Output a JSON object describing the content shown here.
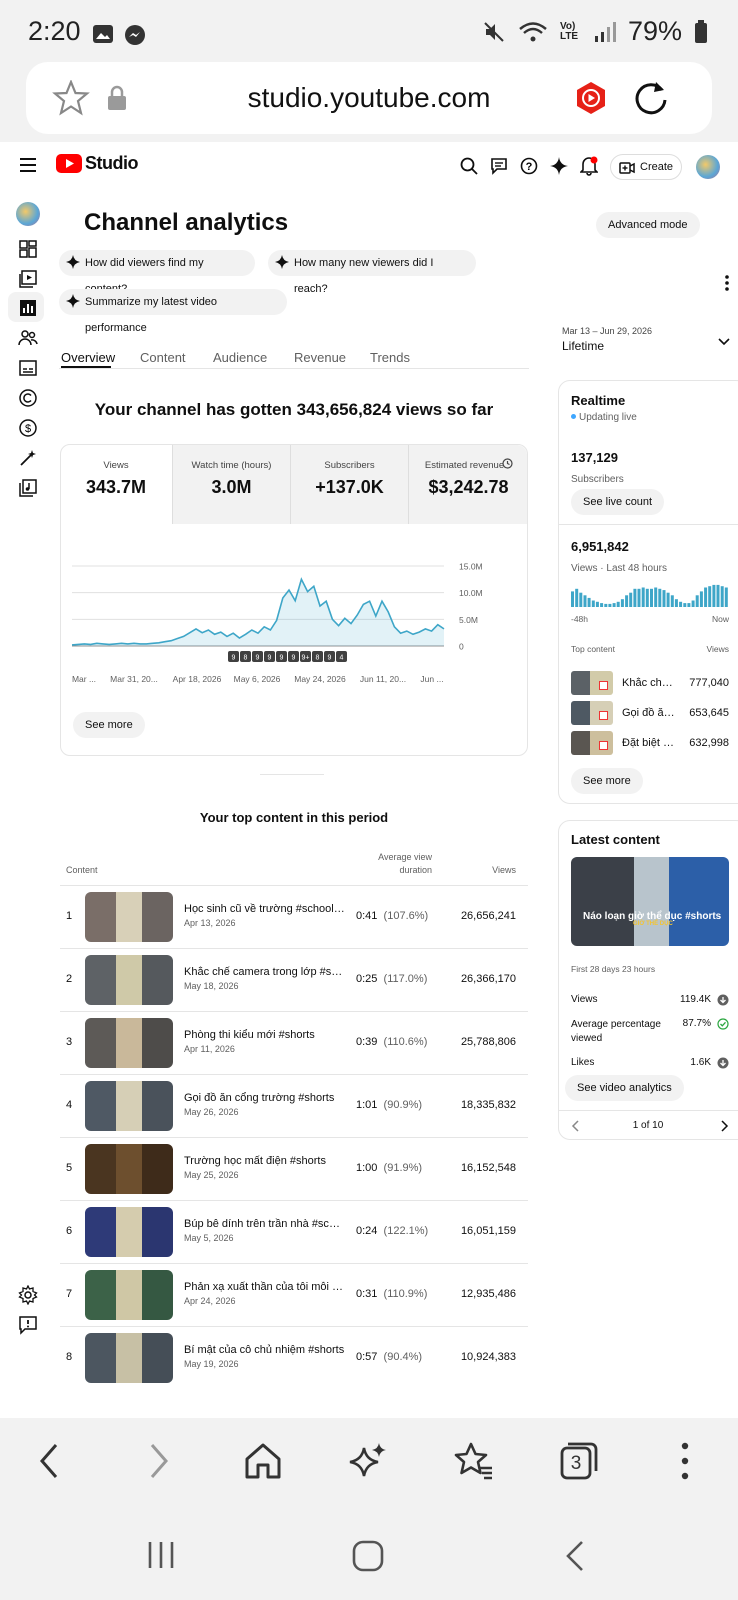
{
  "status_bar": {
    "time": "2:20",
    "battery": "79%",
    "lte_label": "Vo) LTE"
  },
  "browser": {
    "url": "studio.youtube.com",
    "tab_count": "3"
  },
  "studio": {
    "logo_text": "Studio",
    "create_label": "Create"
  },
  "header": {
    "title": "Channel analytics",
    "advanced_mode": "Advanced mode"
  },
  "ai_chips": [
    "How did viewers find my content?",
    "How many new viewers did I reach?",
    "Summarize my latest video performance"
  ],
  "tabs": [
    "Overview",
    "Content",
    "Audience",
    "Revenue",
    "Trends"
  ],
  "date_range": {
    "range": "Mar 13 – Jun 29, 2026",
    "label": "Lifetime"
  },
  "summary_headline": "Your channel has gotten 343,656,824 views so far",
  "metrics": [
    {
      "label": "Views",
      "value": "343.7M"
    },
    {
      "label": "Watch time (hours)",
      "value": "3.0M"
    },
    {
      "label": "Subscribers",
      "value": "+137.0K"
    },
    {
      "label": "Estimated revenue",
      "value": "$3,242.78"
    }
  ],
  "chart_data": {
    "type": "area",
    "x_tick_labels": [
      "Mar ...",
      "Mar 31, 20...",
      "Apr 18, 2026",
      "May 6, 2026",
      "May 24, 2026",
      "Jun 11, 20...",
      "Jun ..."
    ],
    "y_tick_labels": [
      "15.0M",
      "10.0M",
      "5.0M",
      "0"
    ],
    "ylim": [
      0,
      15000000
    ],
    "values": [
      0.2,
      0.3,
      0.4,
      0.3,
      0.5,
      0.4,
      0.3,
      0.4,
      0.5,
      0.4,
      0.5,
      0.4,
      0.4,
      0.5,
      0.6,
      0.8,
      1.0,
      1.4,
      1.8,
      2.5,
      3.2,
      2.5,
      3.0,
      2.2,
      2.6,
      1.8,
      2.4,
      1.5,
      2.2,
      3.0,
      2.4,
      3.6,
      3.0,
      4.8,
      9.0,
      10.5,
      8.5,
      12.5,
      10.2,
      11.2,
      7.5,
      8.4,
      5.0,
      3.8,
      5.2,
      4.2,
      5.8,
      7.8,
      8.4,
      5.6,
      8.4,
      6.4,
      3.6,
      2.4,
      2.8,
      2.2,
      2.6,
      3.2,
      2.8,
      4.0,
      3.2
    ],
    "upload_markers": [
      "9",
      "8",
      "9",
      "9",
      "9",
      "9",
      "9+",
      "8",
      "9",
      "4"
    ]
  },
  "see_more_label": "See more",
  "top_content": {
    "title": "Your top content in this period",
    "col_content": "Content",
    "col_duration": "Average view duration",
    "col_views": "Views",
    "rows": [
      {
        "rank": "1",
        "title": "Học sinh cũ về trường #school #...",
        "date": "Apr 13, 2026",
        "duration": "0:41",
        "pct": "(107.6%)",
        "views": "26,656,241"
      },
      {
        "rank": "2",
        "title": "Khắc chế camera trong lớp #shor...",
        "date": "May 18, 2026",
        "duration": "0:25",
        "pct": "(117.0%)",
        "views": "26,366,170"
      },
      {
        "rank": "3",
        "title": "Phòng thi kiểu mới #shorts",
        "date": "Apr 11, 2026",
        "duration": "0:39",
        "pct": "(110.6%)",
        "views": "25,788,806"
      },
      {
        "rank": "4",
        "title": "Gọi đồ ăn cổng trường #shorts",
        "date": "May 26, 2026",
        "duration": "1:01",
        "pct": "(90.9%)",
        "views": "18,335,832"
      },
      {
        "rank": "5",
        "title": "Trường học mất điện #shorts",
        "date": "May 25, 2026",
        "duration": "1:00",
        "pct": "(91.9%)",
        "views": "16,152,548"
      },
      {
        "rank": "6",
        "title": "Búp bê dính trên trần nhà #schoo...",
        "date": "May 5, 2026",
        "duration": "0:24",
        "pct": "(122.1%)",
        "views": "16,051,159"
      },
      {
        "rank": "7",
        "title": "Phản xạ xuất thần của tôi mỗi khi...",
        "date": "Apr 24, 2026",
        "duration": "0:31",
        "pct": "(110.9%)",
        "views": "12,935,486"
      },
      {
        "rank": "8",
        "title": "Bí mật của cô chủ nhiệm #shorts",
        "date": "May 19, 2026",
        "duration": "0:57",
        "pct": "(90.4%)",
        "views": "10,924,383"
      }
    ]
  },
  "realtime": {
    "title": "Realtime",
    "status": "Updating live",
    "subscribers": "137,129",
    "subscribers_label": "Subscribers",
    "live_count_button": "See live count",
    "views": "6,951,842",
    "views_label": "Views · Last 48 hours",
    "axis_start": "-48h",
    "axis_end": "Now",
    "top_content_label": "Top content",
    "top_views_label": "Views",
    "top_items": [
      {
        "title": "Khắc chế...",
        "views": "777,040"
      },
      {
        "title": "Gọi đồ ăn...",
        "views": "653,645"
      },
      {
        "title": "Đặt biệt d...",
        "views": "632,998"
      }
    ],
    "see_more": "See more"
  },
  "latest": {
    "title": "Latest content",
    "video_title": "Náo loạn giờ thể dục #shorts",
    "thumb_caption": "GIỜ THỂ DỤC",
    "age": "First 28 days 23 hours",
    "stats": [
      {
        "label": "Views",
        "value": "119.4K"
      },
      {
        "label": "Average percentage viewed",
        "value": "87.7%"
      },
      {
        "label": "Likes",
        "value": "1.6K"
      }
    ],
    "analytics_button": "See video analytics",
    "pager": "1 of 10"
  },
  "colors": {
    "accent": "#3ea6c8",
    "brand_red": "#ff0000",
    "live_dot": "#3ea6ff"
  }
}
